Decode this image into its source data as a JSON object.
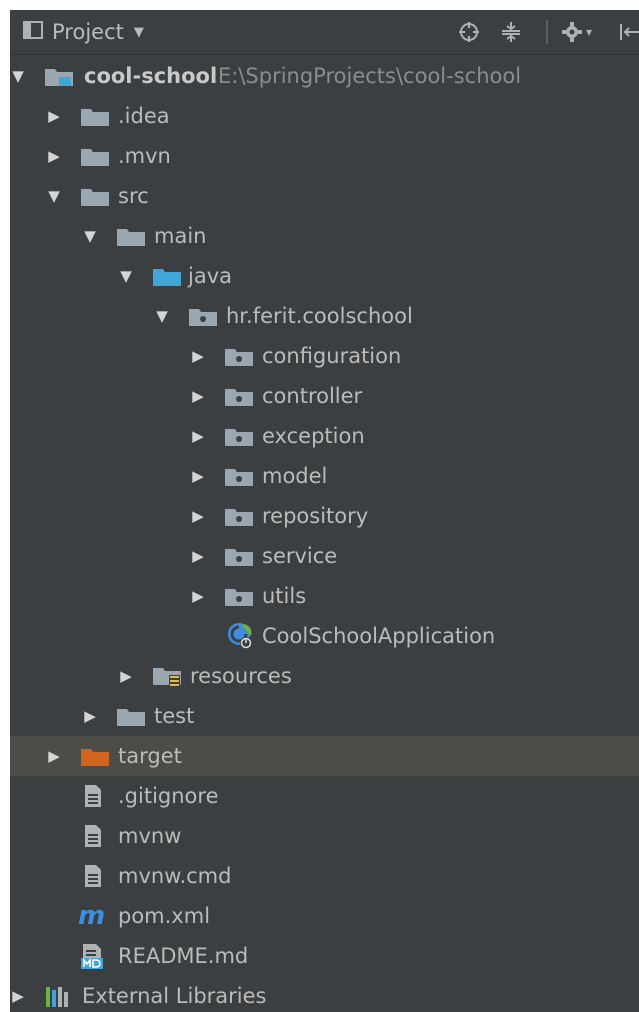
{
  "header": {
    "title": "Project"
  },
  "tree": {
    "root": {
      "name": "cool-school",
      "path": "E:\\SpringProjects\\cool-school"
    },
    "idea": ".idea",
    "mvn": ".mvn",
    "src": "src",
    "main": "main",
    "java": "java",
    "package": "hr.ferit.coolschool",
    "packages": [
      "configuration",
      "controller",
      "exception",
      "model",
      "repository",
      "service",
      "utils"
    ],
    "app_class": "CoolSchoolApplication",
    "resources": "resources",
    "test": "test",
    "target": "target",
    "files": [
      ".gitignore",
      "mvnw",
      "mvnw.cmd"
    ],
    "pom": "pom.xml",
    "readme": "README.md",
    "external": "External Libraries"
  },
  "colors": {
    "panel_bg": "#3c3f41",
    "text": "#bbbbbb",
    "path_text": "#8c8c8c",
    "folder": "#9aa7b0",
    "source_folder": "#40a6d9",
    "excluded_folder": "#d2651e",
    "selected_row": "#4d4c47",
    "maven": "#3d8fdd"
  },
  "icons": {
    "header": [
      "project-view-icon",
      "locate-icon",
      "collapse-icon",
      "settings-icon",
      "hide-icon"
    ],
    "tree": [
      "module-folder-icon",
      "folder-icon",
      "source-folder-icon",
      "package-icon",
      "spring-boot-class-icon",
      "resources-folder-icon",
      "excluded-folder-icon",
      "text-file-icon",
      "maven-icon",
      "markdown-file-icon",
      "libraries-icon"
    ]
  }
}
